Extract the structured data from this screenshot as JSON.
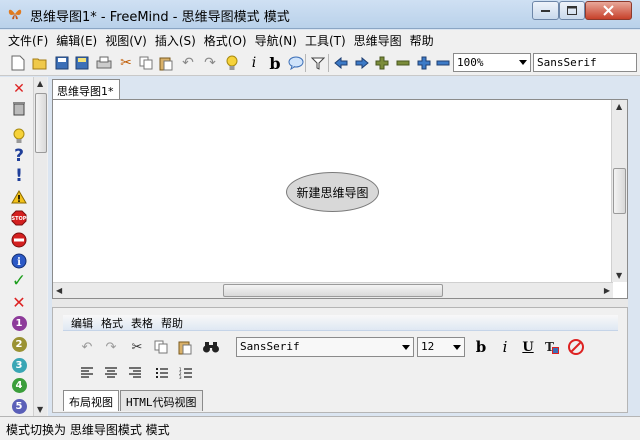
{
  "window": {
    "title": "思维导图1* - FreeMind - 思维导图模式 模式",
    "minimize_label": "—",
    "maximize_label": "□",
    "close_label": "✕"
  },
  "menu": {
    "items": [
      {
        "label": "文件(F)"
      },
      {
        "label": "编辑(E)"
      },
      {
        "label": "视图(V)"
      },
      {
        "label": "插入(S)"
      },
      {
        "label": "格式(O)"
      },
      {
        "label": "导航(N)"
      },
      {
        "label": "工具(T)"
      },
      {
        "label": "思维导图"
      },
      {
        "label": "帮助"
      }
    ]
  },
  "toolbar": {
    "zoom_value": "100%",
    "font_value": "SansSerif"
  },
  "tab": {
    "label": "思维导图1*"
  },
  "canvas": {
    "root_node_label": "新建思维导图"
  },
  "editor": {
    "menu": [
      "编辑",
      "格式",
      "表格",
      "帮助"
    ],
    "font_value": "SansSerif",
    "size_value": "12",
    "tabs": [
      "布局视图",
      "HTML代码视图"
    ]
  },
  "status": {
    "text": "模式切换为 思维导图模式 模式"
  },
  "colors": {
    "accent": "#2a5a9e",
    "node_fill": "#d8d8d8"
  }
}
